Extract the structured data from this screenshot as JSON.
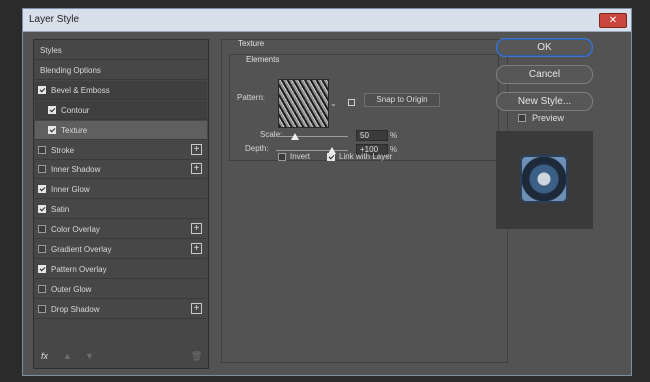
{
  "window": {
    "title": "Layer Style",
    "close_glyph": "✕"
  },
  "left_panel": {
    "items": [
      {
        "label": "Styles",
        "checkbox": null,
        "checked": false,
        "plus": false,
        "sub": false
      },
      {
        "label": "Blending Options",
        "checkbox": null,
        "checked": false,
        "plus": false,
        "sub": false
      },
      {
        "label": "Bevel & Emboss",
        "checkbox": true,
        "checked": true,
        "plus": false,
        "sub": false
      },
      {
        "label": "Contour",
        "checkbox": true,
        "checked": true,
        "plus": false,
        "sub": true
      },
      {
        "label": "Texture",
        "checkbox": true,
        "checked": true,
        "plus": false,
        "sub": true
      },
      {
        "label": "Stroke",
        "checkbox": true,
        "checked": false,
        "plus": true,
        "sub": false
      },
      {
        "label": "Inner Shadow",
        "checkbox": true,
        "checked": false,
        "plus": true,
        "sub": false
      },
      {
        "label": "Inner Glow",
        "checkbox": true,
        "checked": true,
        "plus": false,
        "sub": false
      },
      {
        "label": "Satin",
        "checkbox": true,
        "checked": true,
        "plus": false,
        "sub": false
      },
      {
        "label": "Color Overlay",
        "checkbox": true,
        "checked": false,
        "plus": true,
        "sub": false
      },
      {
        "label": "Gradient Overlay",
        "checkbox": true,
        "checked": false,
        "plus": true,
        "sub": false
      },
      {
        "label": "Pattern Overlay",
        "checkbox": true,
        "checked": true,
        "plus": false,
        "sub": false
      },
      {
        "label": "Outer Glow",
        "checkbox": true,
        "checked": false,
        "plus": false,
        "sub": false
      },
      {
        "label": "Drop Shadow",
        "checkbox": true,
        "checked": false,
        "plus": true,
        "sub": false
      }
    ],
    "plus_glyph": "+",
    "footer": {
      "fx": "fx",
      "up_icon": "up-arrow-icon",
      "down_icon": "down-arrow-icon",
      "trash_icon": "trash-icon",
      "up_glyph": "▲",
      "down_glyph": "▼",
      "trash_glyph": "🗑"
    }
  },
  "texture": {
    "section_title": "Texture",
    "group_title": "Elements",
    "pattern_label": "Pattern:",
    "caret_glyph": "⌄",
    "snap_button": "Snap to Origin",
    "scale_label": "Scale:",
    "scale_value": "50",
    "scale_percent": 50,
    "depth_label": "Depth:",
    "depth_value": "+100",
    "depth_percent": 100,
    "percent_sign": "%",
    "invert_label": "Invert",
    "invert_checked": false,
    "link_label": "Link with Layer",
    "link_checked": true
  },
  "buttons": {
    "ok": "OK",
    "cancel": "Cancel",
    "new_style": "New Style..."
  },
  "preview": {
    "label": "Preview",
    "checked": false
  }
}
